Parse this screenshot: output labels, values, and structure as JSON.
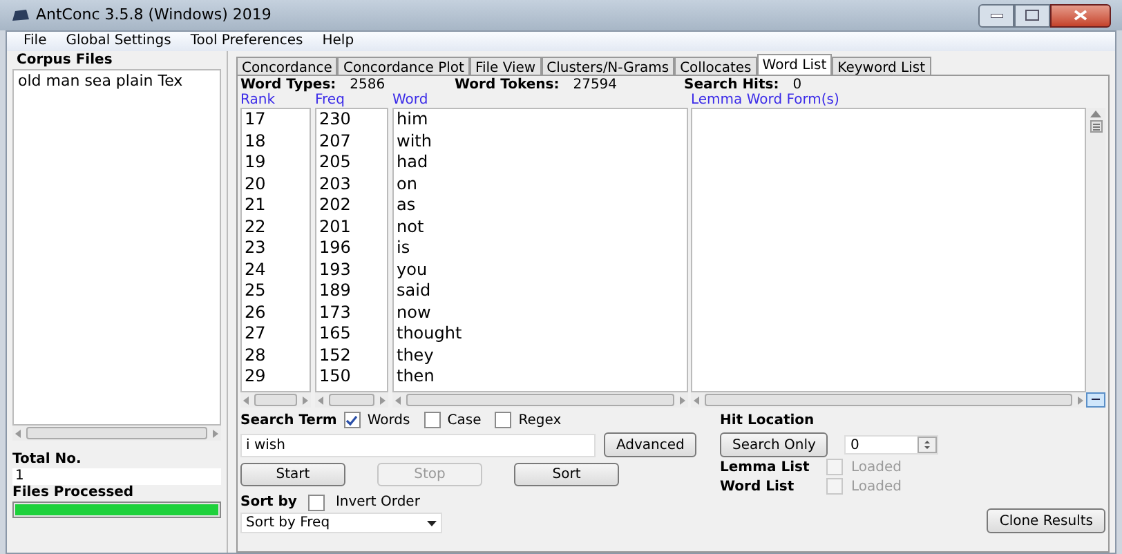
{
  "window": {
    "title": "AntConc 3.5.8 (Windows) 2019"
  },
  "menu": [
    "File",
    "Global Settings",
    "Tool Preferences",
    "Help"
  ],
  "sidebar": {
    "title": "Corpus Files",
    "files": [
      "old man sea plain Tex"
    ],
    "total_label": "Total No.",
    "total_value": "1",
    "processed_label": "Files Processed",
    "progress": {
      "level": 1
    }
  },
  "tabs": [
    {
      "label": "Concordance",
      "selected": false
    },
    {
      "label": "Concordance Plot",
      "selected": false
    },
    {
      "label": "File View",
      "selected": false
    },
    {
      "label": "Clusters/N-Grams",
      "selected": false
    },
    {
      "label": "Collocates",
      "selected": false
    },
    {
      "label": "Word List",
      "selected": true
    },
    {
      "label": "Keyword List",
      "selected": false
    }
  ],
  "stats": [
    {
      "label": "Word Types:",
      "value": "2586"
    },
    {
      "label": "Word Tokens:",
      "value": "27594"
    },
    {
      "label": "Search Hits:",
      "value": "0"
    }
  ],
  "table": {
    "columns": [
      "Rank",
      "Freq",
      "Word"
    ],
    "lemma_column": "Lemma Word Form(s)",
    "rows": [
      [
        "17",
        "230",
        "him"
      ],
      [
        "18",
        "207",
        "with"
      ],
      [
        "19",
        "205",
        "had"
      ],
      [
        "20",
        "203",
        "on"
      ],
      [
        "21",
        "202",
        "as"
      ],
      [
        "22",
        "201",
        "not"
      ],
      [
        "23",
        "196",
        "is"
      ],
      [
        "24",
        "193",
        "you"
      ],
      [
        "25",
        "189",
        "said"
      ],
      [
        "26",
        "173",
        "now"
      ],
      [
        "27",
        "165",
        "thought"
      ],
      [
        "28",
        "152",
        "they"
      ],
      [
        "29",
        "150",
        "then"
      ]
    ]
  },
  "search": {
    "label": "Search Term",
    "options": [
      {
        "label": "Words",
        "checked": true
      },
      {
        "label": "Case",
        "checked": false
      },
      {
        "label": "Regex",
        "checked": false
      }
    ],
    "value": "i wish",
    "advanced": "Advanced"
  },
  "buttons": [
    {
      "label": "Start",
      "disabled": false
    },
    {
      "label": "Stop",
      "disabled": true
    },
    {
      "label": "Sort",
      "disabled": false
    }
  ],
  "sort": {
    "label": "Sort by",
    "invert": {
      "label": "Invert Order",
      "checked": false
    },
    "value": "Sort by Freq"
  },
  "hit_location": {
    "label": "Hit Location",
    "button": "Search Only",
    "value": "0"
  },
  "loaded": [
    {
      "label": "Lemma List",
      "option": "Loaded",
      "checked": false
    },
    {
      "label": "Word List",
      "option": "Loaded",
      "checked": false
    }
  ],
  "clone": "Clone Results"
}
